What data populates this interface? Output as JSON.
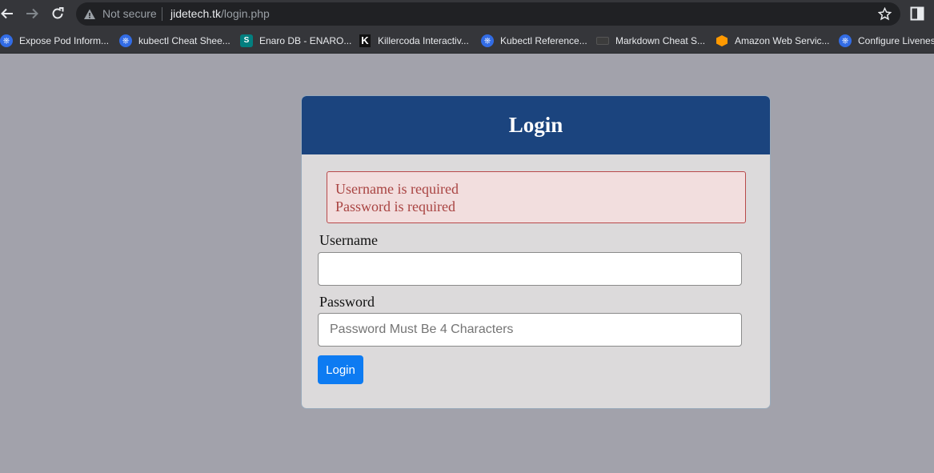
{
  "browser": {
    "security_label": "Not secure",
    "url_host": "jidetech.tk",
    "url_path": "/login.php",
    "bookmarks": [
      {
        "label": "Expose Pod Inform...",
        "icon": "kubernetes-icon"
      },
      {
        "label": "kubectl Cheat Shee...",
        "icon": "kubernetes-icon"
      },
      {
        "label": "Enaro DB - ENARO...",
        "icon": "sharepoint-icon"
      },
      {
        "label": "Killercoda Interactiv...",
        "icon": "killercoda-icon"
      },
      {
        "label": "Kubectl Reference...",
        "icon": "kubernetes-icon"
      },
      {
        "label": "Markdown Cheat S...",
        "icon": "markdown-icon"
      },
      {
        "label": "Amazon Web Servic...",
        "icon": "aws-icon"
      },
      {
        "label": "Configure Livenes",
        "icon": "kubernetes-icon"
      }
    ]
  },
  "login": {
    "title": "Login",
    "errors": [
      "Username is required",
      "Password is required"
    ],
    "username_label": "Username",
    "username_value": "",
    "password_label": "Password",
    "password_placeholder": "Password Must Be 4 Characters",
    "submit_label": "Login"
  },
  "colors": {
    "page_background": "#a2a2ab",
    "header_background": "#1b447e",
    "alert_background": "#f2dede",
    "alert_text": "#a94442",
    "button_background": "#0d7bf2"
  }
}
